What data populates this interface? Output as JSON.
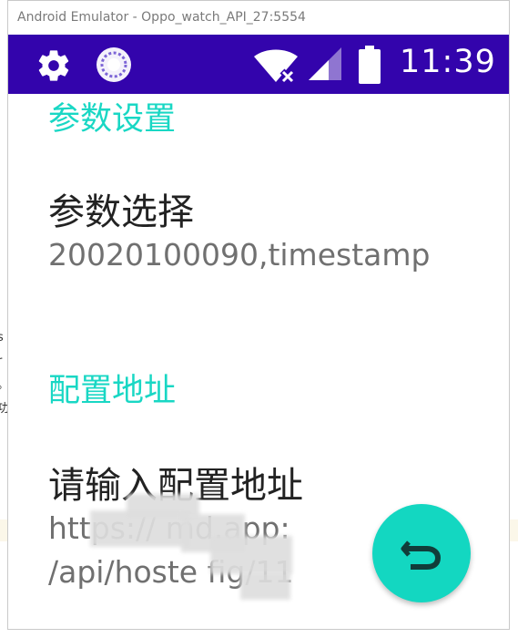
{
  "window": {
    "title": "Android Emulator - Oppo_watch_API_27:5554"
  },
  "status_bar": {
    "time": "11:39",
    "background_color": "#3304ac",
    "icons": [
      "gear-icon",
      "sync-icon",
      "wifi-off-icon",
      "cell-signal-icon",
      "battery-icon"
    ]
  },
  "settings": {
    "section_parameters": "参数设置",
    "param_select_title": "参数选择",
    "param_select_summary": "20020100090,timestamp",
    "section_config": "配置地址",
    "config_title": "请输入配置地址",
    "config_summary_line1": "https://                     md.app:",
    "config_summary_line2": "/api/hoste                 fig/11"
  },
  "fab": {
    "icon": "undo-icon",
    "color": "#13d7c1"
  },
  "accent_color": "#19d7c4"
}
